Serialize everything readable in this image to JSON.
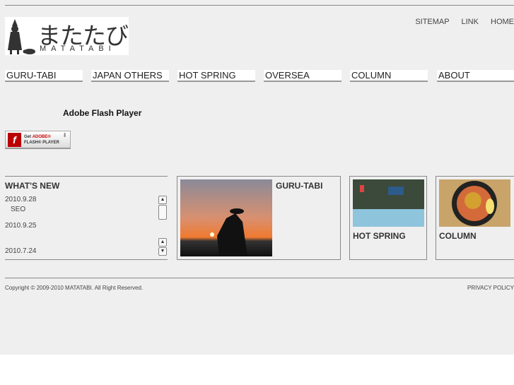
{
  "logo": {
    "jp": "またたび",
    "en": "MATATABI"
  },
  "top_links": [
    "SITEMAP",
    "LINK",
    "HOME"
  ],
  "nav": [
    "GURU-TABI",
    "JAPAN OTHERS",
    "HOT SPRING",
    "OVERSEA",
    "COLUMN",
    "ABOUT"
  ],
  "flash": {
    "title": "Adobe Flash Player",
    "badge_get": "Get",
    "badge_adobe": "ADOBE®",
    "badge_player": "FLASH® PLAYER"
  },
  "news": {
    "title": "WHAT'S NEW",
    "items": [
      {
        "date": "2010.9.28",
        "text": "SEO"
      },
      {
        "date": "2010.9.25",
        "text": ""
      },
      {
        "date": "2010.7.24",
        "text": ""
      }
    ]
  },
  "cards": [
    {
      "label": "GURU-TABI"
    },
    {
      "label": "HOT SPRING"
    },
    {
      "label": "COLUMN"
    }
  ],
  "footer": {
    "copyright": "Copyright © 2009-2010 MATATABI. All Right Reserved.",
    "privacy": "PRIVACY POLICY"
  }
}
